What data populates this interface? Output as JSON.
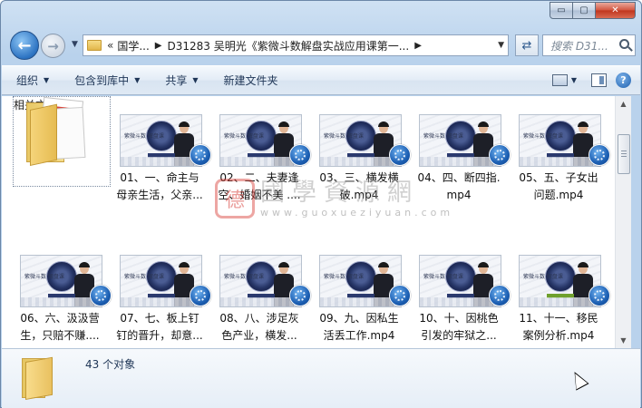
{
  "window": {
    "minimize": "▭",
    "maximize": "▢",
    "close": "✕"
  },
  "address_bar": {
    "overflow_chevron": "«",
    "crumbs": [
      "国学...",
      "D31283 吴明光《紫微斗数解盘实战应用课第一..."
    ],
    "separator": "▶",
    "dropdown": "▼"
  },
  "navigation": {
    "back": "←",
    "forward": "→",
    "history_dropdown": "▼"
  },
  "search": {
    "placeholder": "搜索 D31..."
  },
  "toolbar": {
    "organize": "组织",
    "include_in_library": "包含到库中",
    "share": "共享",
    "new_folder": "新建文件夹",
    "dropdown_arrow": "▼",
    "help": "?"
  },
  "items": [
    {
      "label": "相关文件",
      "kind": "folder"
    },
    {
      "label": "01、一、命主与\n母亲生活，父亲...",
      "kind": "video"
    },
    {
      "label": "02、二、夫妻逢\n空、婚姻不美 ....",
      "kind": "video"
    },
    {
      "label": "03、三、横发横\n破.mp4",
      "kind": "video"
    },
    {
      "label": "04、四、断四指.\nmp4",
      "kind": "video"
    },
    {
      "label": "05、五、子女出\n问题.mp4",
      "kind": "video"
    },
    {
      "label": "06、六、汲汲营\n生，只赔不赚....",
      "kind": "video"
    },
    {
      "label": "07、七、板上钉\n钉的晋升，却意...",
      "kind": "video"
    },
    {
      "label": "08、八、涉足灰\n色产业，横发...",
      "kind": "video"
    },
    {
      "label": "09、九、因私生\n活丢工作.mp4",
      "kind": "video"
    },
    {
      "label": "10、十、因桃色\n引发的牢狱之...",
      "kind": "video"
    },
    {
      "label": "11、十一、移民\n案例分析.mp4",
      "kind": "video"
    }
  ],
  "thumbnail": {
    "course_title": "紫微斗数\n解盘课"
  },
  "watermark": {
    "seal": "德",
    "title": "國學資源網",
    "url": "www.guoxueziyuan.com"
  },
  "details": {
    "object_count": "43 个对象"
  },
  "scrollbar": {
    "up": "▲",
    "down": "▼"
  }
}
